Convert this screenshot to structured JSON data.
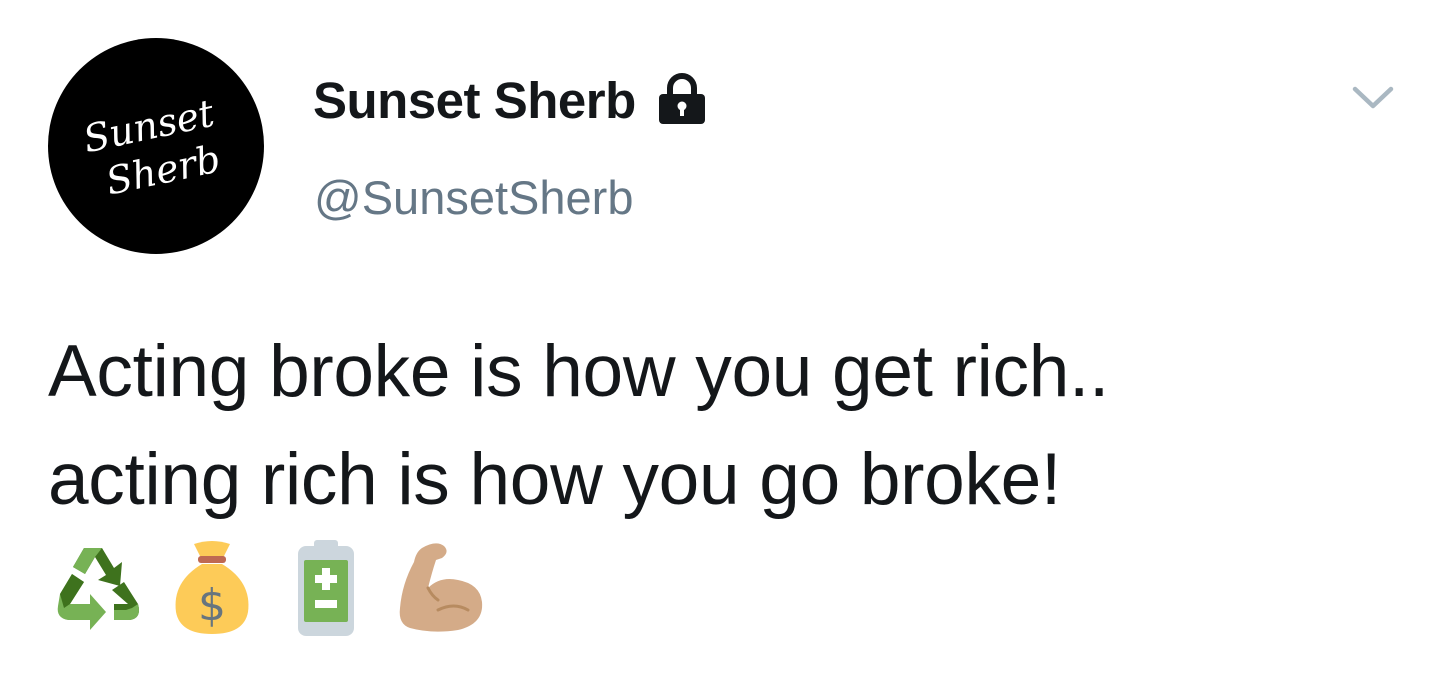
{
  "tweet": {
    "avatar": {
      "logo_line1": "Sunset",
      "logo_line2": "Sherb",
      "background": "#000000"
    },
    "author": {
      "display_name": "Sunset Sherb",
      "handle": "@SunsetSherb",
      "protected_icon": "lock-icon"
    },
    "menu_icon": "chevron-down-icon",
    "text_lines": [
      "Acting broke is how you get rich..",
      "acting rich is how you go broke!"
    ],
    "emojis": [
      {
        "name": "recycling-symbol-emoji"
      },
      {
        "name": "money-bag-emoji"
      },
      {
        "name": "battery-emoji"
      },
      {
        "name": "flexed-biceps-emoji"
      }
    ],
    "colors": {
      "text": "#14171a",
      "secondary_text": "#657786",
      "caret": "#aab8c2"
    }
  }
}
